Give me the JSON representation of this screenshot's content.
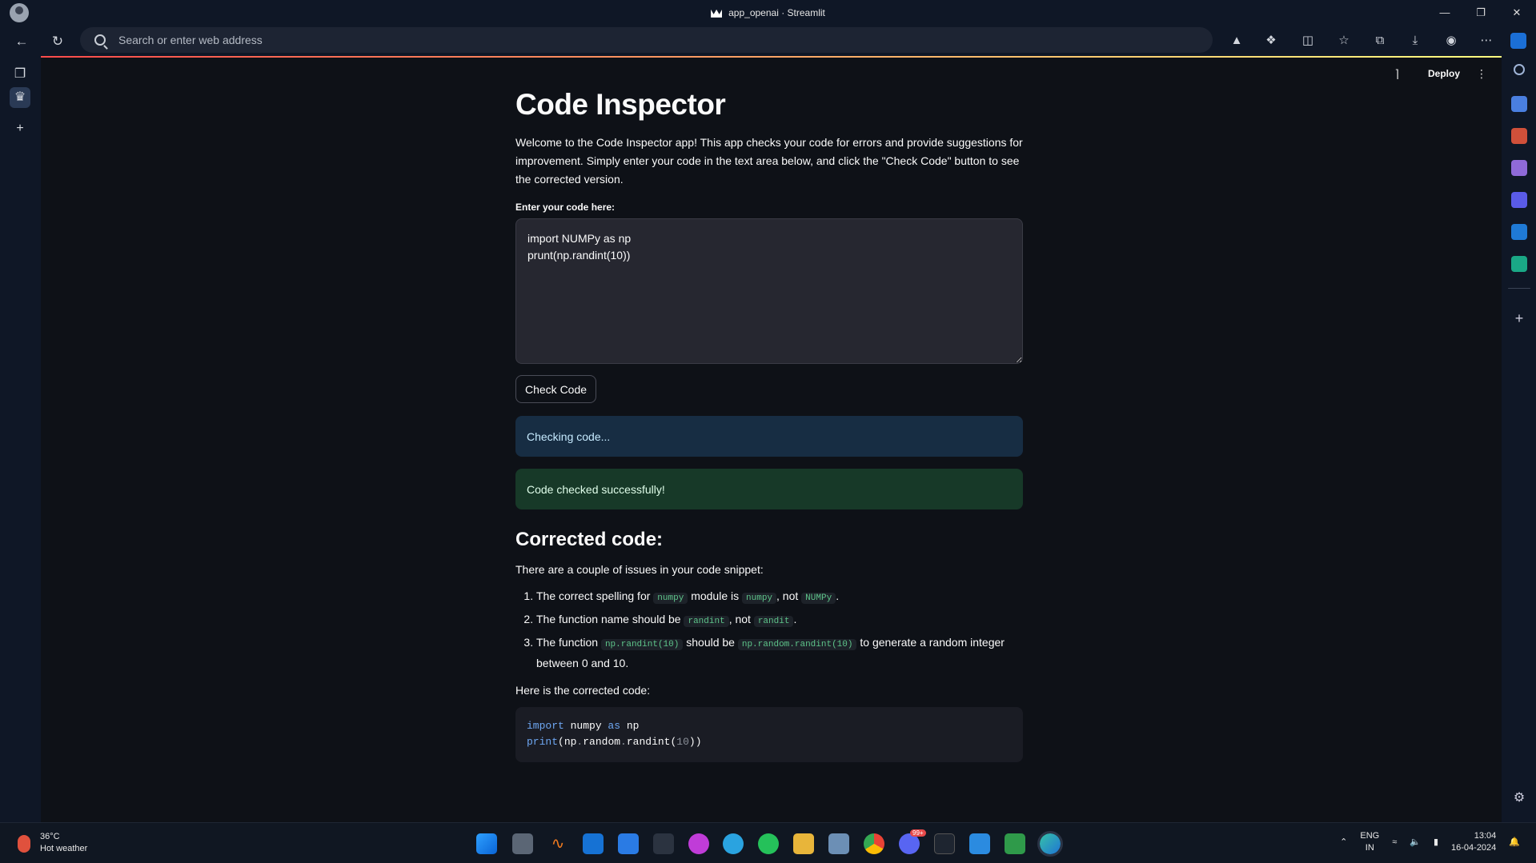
{
  "window": {
    "title": "app_openai · Streamlit"
  },
  "browser": {
    "address_placeholder": "Search or enter web address"
  },
  "streamlit": {
    "deploy_label": "Deploy"
  },
  "app": {
    "title": "Code Inspector",
    "intro": "Welcome to the Code Inspector app! This app checks your code for errors and provide suggestions for improvement. Simply enter your code in the text area below, and click the \"Check Code\" button to see the corrected version.",
    "input_label": "Enter your code here:",
    "input_value": "import NUMPy as np\nprunt(np.randint(10))",
    "check_button": "Check Code",
    "info_text": "Checking code...",
    "success_text": "Code checked successfully!",
    "corrected_heading": "Corrected code:",
    "summary": "There are a couple of issues in your code snippet:",
    "issues": [
      {
        "a": "The correct spelling for ",
        "c1": "numpy",
        "b": " module is ",
        "c2": "numpy",
        "c": ", not ",
        "c3": "NUMPy",
        "d": "."
      },
      {
        "a": "The function name should be ",
        "c1": "randint",
        "b": ", not ",
        "c2": "randit",
        "c": ".",
        "c3": "",
        "d": ""
      },
      {
        "a": "The function ",
        "c1": "np.randint(10)",
        "b": " should be ",
        "c2": "np.random.randint(10)",
        "c": " to generate a random integer between 0 and 10.",
        "c3": "",
        "d": ""
      }
    ],
    "corrected_intro": "Here is the corrected code:",
    "code_lines": [
      [
        {
          "t": "import",
          "k": "kw"
        },
        {
          "t": " numpy ",
          "k": ""
        },
        {
          "t": "as",
          "k": "kw"
        },
        {
          "t": " np",
          "k": ""
        }
      ],
      [
        {
          "t": "print",
          "k": "fn"
        },
        {
          "t": "(np",
          "k": ""
        },
        {
          "t": ".",
          "k": "num"
        },
        {
          "t": "random",
          "k": ""
        },
        {
          "t": ".",
          "k": "num"
        },
        {
          "t": "randint(",
          "k": ""
        },
        {
          "t": "10",
          "k": "num"
        },
        {
          "t": "))",
          "k": ""
        }
      ]
    ]
  },
  "taskbar": {
    "temperature": "36°C",
    "weather": "Hot weather",
    "lang1": "ENG",
    "lang2": "IN",
    "time": "13:04",
    "date": "16-04-2024",
    "discord_badge": "99+"
  },
  "colors": {
    "accent": "#ff4b4b",
    "info_bg": "#172d43",
    "success_bg": "#173928"
  }
}
